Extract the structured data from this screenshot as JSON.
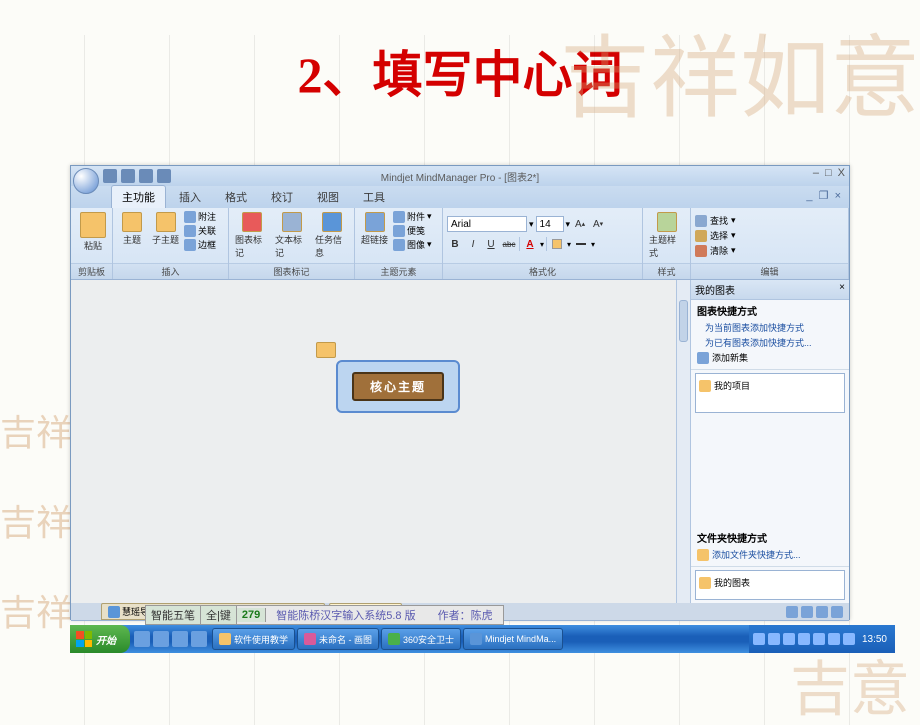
{
  "slide": {
    "title": "2、填写中心词"
  },
  "app": {
    "title": "Mindjet MindManager Pro - [图表2*]",
    "tabs": [
      "主功能",
      "插入",
      "格式",
      "校订",
      "视图",
      "工具"
    ],
    "active_tab": 0,
    "help_icon": "◉",
    "winctrl": {
      "min": "–",
      "max": "□",
      "close": "X",
      "min2": "_",
      "restore": "❐",
      "close2": "×"
    }
  },
  "ribbon": {
    "groups": {
      "clipboard": {
        "label": "剪贴板",
        "paste": "粘贴"
      },
      "insert": {
        "label": "插入",
        "topic": "主题",
        "subtopic": "子主题",
        "attach": "附注",
        "relation": "关联",
        "boundary": "边框"
      },
      "markers": {
        "label": "图表标记",
        "chart_mark": "图表标记",
        "text_mark": "文本标记",
        "task_info": "任务信息"
      },
      "elements": {
        "label": "主题元素",
        "hyperlink": "超链接",
        "attachment": "附件",
        "note": "便笺",
        "image": "图像"
      },
      "format": {
        "label": "格式化",
        "font_name": "Arial",
        "font_size": "14",
        "bold": "B",
        "italic": "I",
        "underline": "U",
        "strike": "abc",
        "color": "A"
      },
      "style": {
        "label": "样式",
        "theme_style": "主题样式"
      },
      "edit": {
        "label": "编辑",
        "find": "查找",
        "select": "选择",
        "clear": "清除"
      }
    }
  },
  "canvas": {
    "topic_text": "核心主题"
  },
  "right_panel": {
    "title": "我的图表",
    "section1": {
      "hdr": "图表快捷方式",
      "link1": "为当前图表添加快捷方式",
      "link2": "为已有图表添加快捷方式...",
      "add_set": "添加新集"
    },
    "box1_item": "我的项目",
    "section2": {
      "hdr": "文件夹快捷方式",
      "link": "添加文件夹快捷方式..."
    },
    "box2_item": "我的图表"
  },
  "doc_tabs": {
    "tab1": "慧瑶导图教学 - - MM7软件使用 QQ:842792424",
    "tab2": "核心主题"
  },
  "ime": {
    "name": "智能五笔",
    "mode": "全|键",
    "count": "279",
    "status": "智能陈桥汉字输入系统5.8 版　　作者：陈虎"
  },
  "taskbar": {
    "start": "开始",
    "tasks": [
      "软件使用教学",
      "未命名 - 画图",
      "360安全卫士",
      "Mindjet MindMa..."
    ],
    "time": "13:50"
  }
}
